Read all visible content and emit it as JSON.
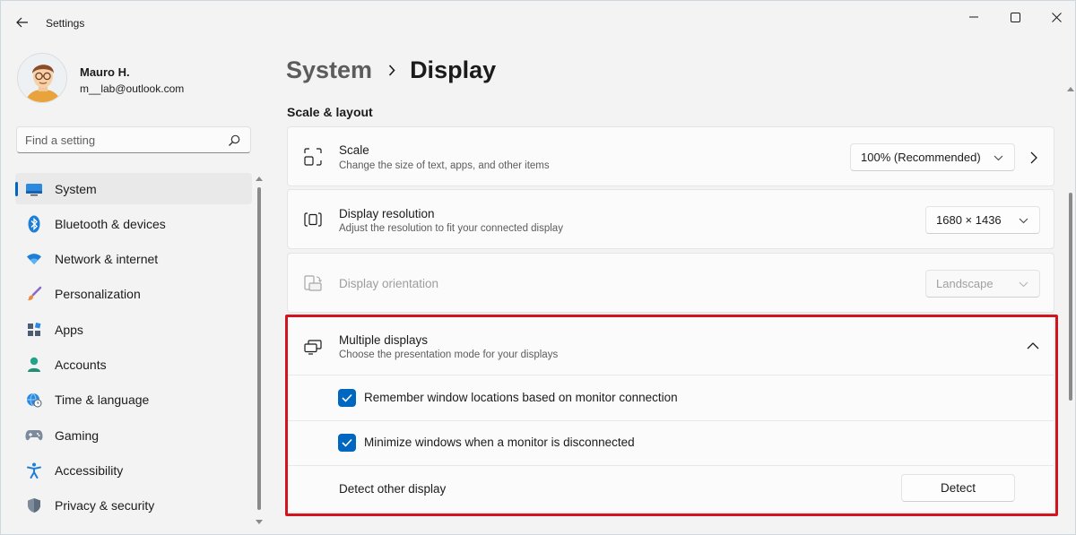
{
  "window": {
    "title": "Settings"
  },
  "user": {
    "name": "Mauro H.",
    "email": "m__lab@outlook.com"
  },
  "search": {
    "placeholder": "Find a setting"
  },
  "sidebar": {
    "items": [
      {
        "label": "System",
        "icon": "monitor-icon",
        "active": true
      },
      {
        "label": "Bluetooth & devices",
        "icon": "bluetooth-icon"
      },
      {
        "label": "Network & internet",
        "icon": "wifi-icon"
      },
      {
        "label": "Personalization",
        "icon": "brush-icon"
      },
      {
        "label": "Apps",
        "icon": "apps-icon"
      },
      {
        "label": "Accounts",
        "icon": "person-icon"
      },
      {
        "label": "Time & language",
        "icon": "globe-clock-icon"
      },
      {
        "label": "Gaming",
        "icon": "gamepad-icon"
      },
      {
        "label": "Accessibility",
        "icon": "accessibility-icon"
      },
      {
        "label": "Privacy & security",
        "icon": "shield-icon"
      }
    ]
  },
  "breadcrumb": {
    "parent": "System",
    "current": "Display"
  },
  "section": {
    "title": "Scale & layout"
  },
  "scale": {
    "title": "Scale",
    "subtitle": "Change the size of text, apps, and other items",
    "value": "100% (Recommended)"
  },
  "resolution": {
    "title": "Display resolution",
    "subtitle": "Adjust the resolution to fit your connected display",
    "value": "1680 × 1436"
  },
  "orientation": {
    "title": "Display orientation",
    "value": "Landscape",
    "disabled": true
  },
  "multiple_displays": {
    "title": "Multiple displays",
    "subtitle": "Choose the presentation mode for your displays",
    "expanded": true,
    "remember_label": "Remember window locations based on monitor connection",
    "remember_checked": true,
    "minimize_label": "Minimize windows when a monitor is disconnected",
    "minimize_checked": true,
    "detect_label": "Detect other display",
    "detect_button": "Detect"
  },
  "colors": {
    "accent": "#0067c0",
    "highlight": "#d3141d"
  }
}
